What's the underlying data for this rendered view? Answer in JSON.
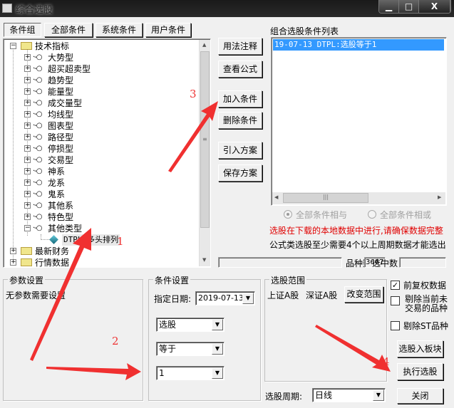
{
  "window": {
    "title": "综合选股",
    "minimize": "▁",
    "maximize": "□",
    "close": "X"
  },
  "tabs": [
    {
      "label": "条件组"
    },
    {
      "label": "全部条件"
    },
    {
      "label": "系统条件"
    },
    {
      "label": "用户条件"
    }
  ],
  "tree": {
    "root": "技术指标",
    "children": [
      "大势型",
      "超买超卖型",
      "趋势型",
      "能量型",
      "成交量型",
      "均线型",
      "图表型",
      "路径型",
      "停损型",
      "交易型",
      "神系",
      "龙系",
      "鬼系",
      "其他系",
      "特色型",
      "其他类型"
    ],
    "leaf": "DTPL  多头排列",
    "others": [
      "最新财务",
      "行情数据"
    ]
  },
  "buttons": {
    "usage": "用法注释",
    "view_formula": "查看公式",
    "add": "加入条件",
    "delete": "删除条件",
    "import": "引入方案",
    "save": "保存方案"
  },
  "condition_list": {
    "label": "组合选股条件列表",
    "items": [
      "19-07-13 DTPL:选股等于1"
    ]
  },
  "logic": {
    "and": "全部条件相与",
    "or": "全部条件相或"
  },
  "notice": {
    "red": "选股在下载的本地数据中进行,请确保数据完整",
    "black": "公式类选股至少需要4个以上周期数据才能选出"
  },
  "status": {
    "count_label": "品种数",
    "count": "3667",
    "selected_label": "选中数",
    "selected": ""
  },
  "params": {
    "title": "参数设置",
    "text": "无参数需要设置"
  },
  "cond_settings": {
    "title": "条件设置",
    "date_label": "指定日期:",
    "date": "2019-07-13",
    "select1": "选股",
    "select2": "等于",
    "select3": "1"
  },
  "range": {
    "title": "选股范围",
    "sh": "上证A股",
    "sz": "深证A股",
    "change": "改变范围"
  },
  "options": [
    {
      "label": "前复权数据",
      "checked": true
    },
    {
      "label": "剔除当前未交易的品种",
      "checked": false
    },
    {
      "label": "剔除ST品种",
      "checked": false
    }
  ],
  "actions": {
    "to_block": "选股入板块",
    "execute": "执行选股",
    "close": "关闭"
  },
  "period": {
    "label": "选股周期:",
    "value": "日线"
  },
  "annotations": [
    "1",
    "2",
    "3",
    "4"
  ],
  "colors": {
    "selection": "#3399ff",
    "notice_red": "#e00000",
    "annotation": "#e83030"
  }
}
